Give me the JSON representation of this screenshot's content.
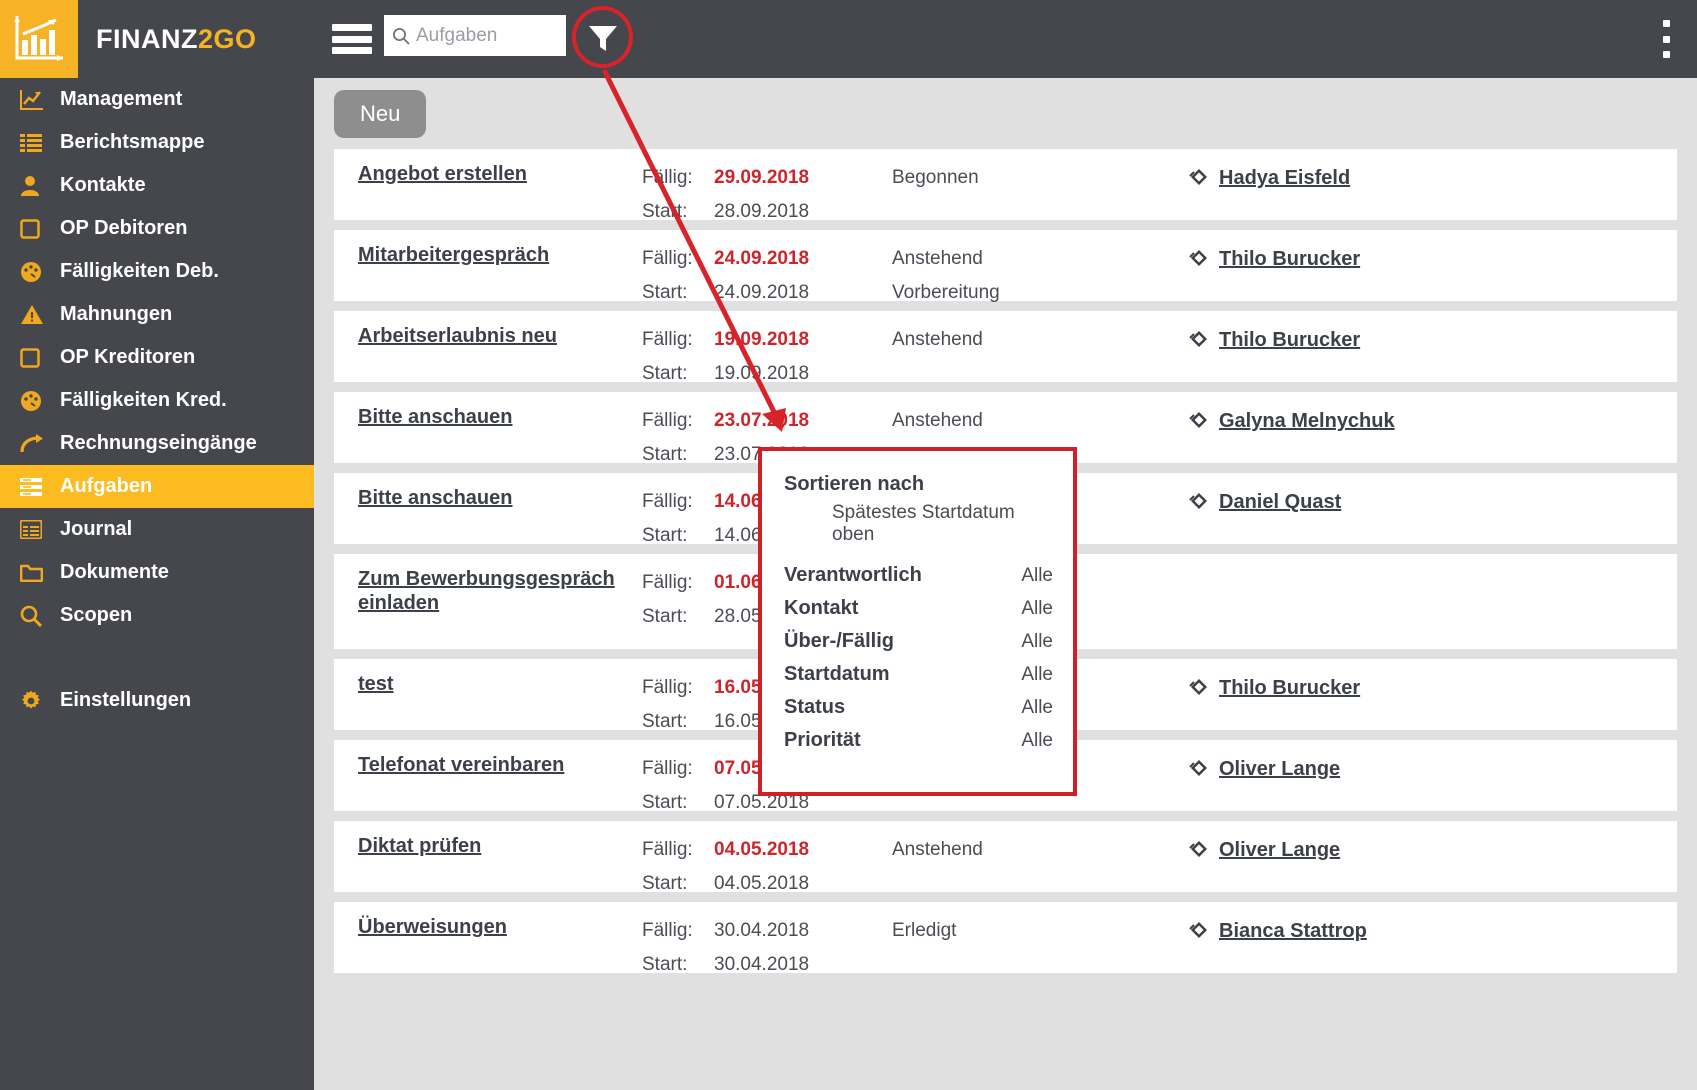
{
  "header": {
    "brand_part1": "FINANZ",
    "brand_part2": "2GO",
    "logo_icon": "bar-chart-growth-icon",
    "menu_icon": "hamburger-menu-icon",
    "search_placeholder": "Aufgaben",
    "search_value": "",
    "search_icon": "search-icon",
    "filter_icon": "funnel-filter-icon",
    "overflow_icon": "kebab-menu-icon",
    "accent_color": "#f5b325",
    "bar_color": "#45474d",
    "highlight_color": "#d8232a"
  },
  "sidebar": {
    "items": [
      {
        "label": "Management",
        "icon": "line-chart-icon",
        "active": false
      },
      {
        "label": "Berichtsmappe",
        "icon": "list-lines-icon",
        "active": false
      },
      {
        "label": "Kontakte",
        "icon": "person-icon",
        "active": false
      },
      {
        "label": "OP Debitoren",
        "icon": "square-outline-icon",
        "active": false
      },
      {
        "label": "Fälligkeiten Deb.",
        "icon": "gauge-icon",
        "active": false
      },
      {
        "label": "Mahnungen",
        "icon": "warning-triangle-icon",
        "active": false
      },
      {
        "label": "OP Kreditoren",
        "icon": "square-outline-icon",
        "active": false
      },
      {
        "label": "Fälligkeiten Kred.",
        "icon": "gauge-icon",
        "active": false
      },
      {
        "label": "Rechnungseingänge",
        "icon": "arrow-curve-right-icon",
        "active": false
      },
      {
        "label": "Aufgaben",
        "icon": "tasks-lines-icon",
        "active": true
      },
      {
        "label": "Journal",
        "icon": "table-window-icon",
        "active": false
      },
      {
        "label": "Dokumente",
        "icon": "folder-icon",
        "active": false
      },
      {
        "label": "Scopen",
        "icon": "magnifier-icon",
        "active": false
      }
    ],
    "settings": {
      "label": "Einstellungen",
      "icon": "gear-icon"
    }
  },
  "toolbar": {
    "new_label": "Neu"
  },
  "list": {
    "due_label": "Fällig:",
    "start_label": "Start:",
    "person_icon": "attachment-tag-icon",
    "rows": [
      {
        "title": "Angebot erstellen",
        "due": "29.09.2018",
        "due_overdue": true,
        "start": "28.09.2018",
        "status1": "Begonnen",
        "status2": "",
        "person": "Hadya Eisfeld",
        "tall": false
      },
      {
        "title": "Mitarbeitergespräch",
        "due": "24.09.2018",
        "due_overdue": true,
        "start": "24.09.2018",
        "status1": "Anstehend",
        "status2": "Vorbereitung",
        "person": "Thilo Burucker",
        "tall": false
      },
      {
        "title": "Arbeitserlaubnis neu",
        "due": "19.09.2018",
        "due_overdue": true,
        "start": "19.09.2018",
        "status1": "Anstehend",
        "status2": "",
        "person": "Thilo Burucker",
        "tall": false
      },
      {
        "title": "Bitte anschauen",
        "due": "23.07.2018",
        "due_overdue": true,
        "start": "23.07.2018",
        "status1": "Anstehend",
        "status2": "",
        "person": "Galyna Melnychuk",
        "tall": false
      },
      {
        "title": "Bitte anschauen",
        "due": "14.06.2018",
        "due_overdue": true,
        "start": "14.06.2018",
        "status1": "",
        "status2": "",
        "person": "Daniel Quast",
        "tall": false
      },
      {
        "title": "Zum Bewerbungsgespräch einladen",
        "due": "01.06.2018",
        "due_overdue": true,
        "start": "28.05.2018",
        "status1": "",
        "status2": "",
        "person": "",
        "tall": true
      },
      {
        "title": "test",
        "due": "16.05.2018",
        "due_overdue": true,
        "start": "16.05.2018",
        "status1": "",
        "status2": "",
        "person": "Thilo Burucker",
        "tall": false
      },
      {
        "title": "Telefonat vereinbaren",
        "due": "07.05.2018",
        "due_overdue": true,
        "start": "07.05.2018",
        "status1": "",
        "status2": "",
        "person": "Oliver Lange",
        "tall": false
      },
      {
        "title": "Diktat prüfen",
        "due": "04.05.2018",
        "due_overdue": true,
        "start": "04.05.2018",
        "status1": "Anstehend",
        "status2": "",
        "person": "Oliver Lange",
        "tall": false
      },
      {
        "title": "Überweisungen",
        "due": "30.04.2018",
        "due_overdue": false,
        "start": "30.04.2018",
        "status1": "Erledigt",
        "status2": "",
        "person": "Bianca Stattrop",
        "tall": false
      }
    ]
  },
  "filter_popup": {
    "sort_label": "Sortieren nach",
    "sort_value": "Spätestes Startdatum oben",
    "entries": [
      {
        "label": "Verantwortlich",
        "value": "Alle"
      },
      {
        "label": "Kontakt",
        "value": "Alle"
      },
      {
        "label": "Über-/Fällig",
        "value": "Alle"
      },
      {
        "label": "Startdatum",
        "value": "Alle"
      },
      {
        "label": "Status",
        "value": "Alle"
      },
      {
        "label": "Priorität",
        "value": "Alle"
      }
    ],
    "border_color": "#cf2027"
  },
  "annotation": {
    "arrow_color": "#d8232a",
    "icon": "pointer-arrow-annotation"
  }
}
